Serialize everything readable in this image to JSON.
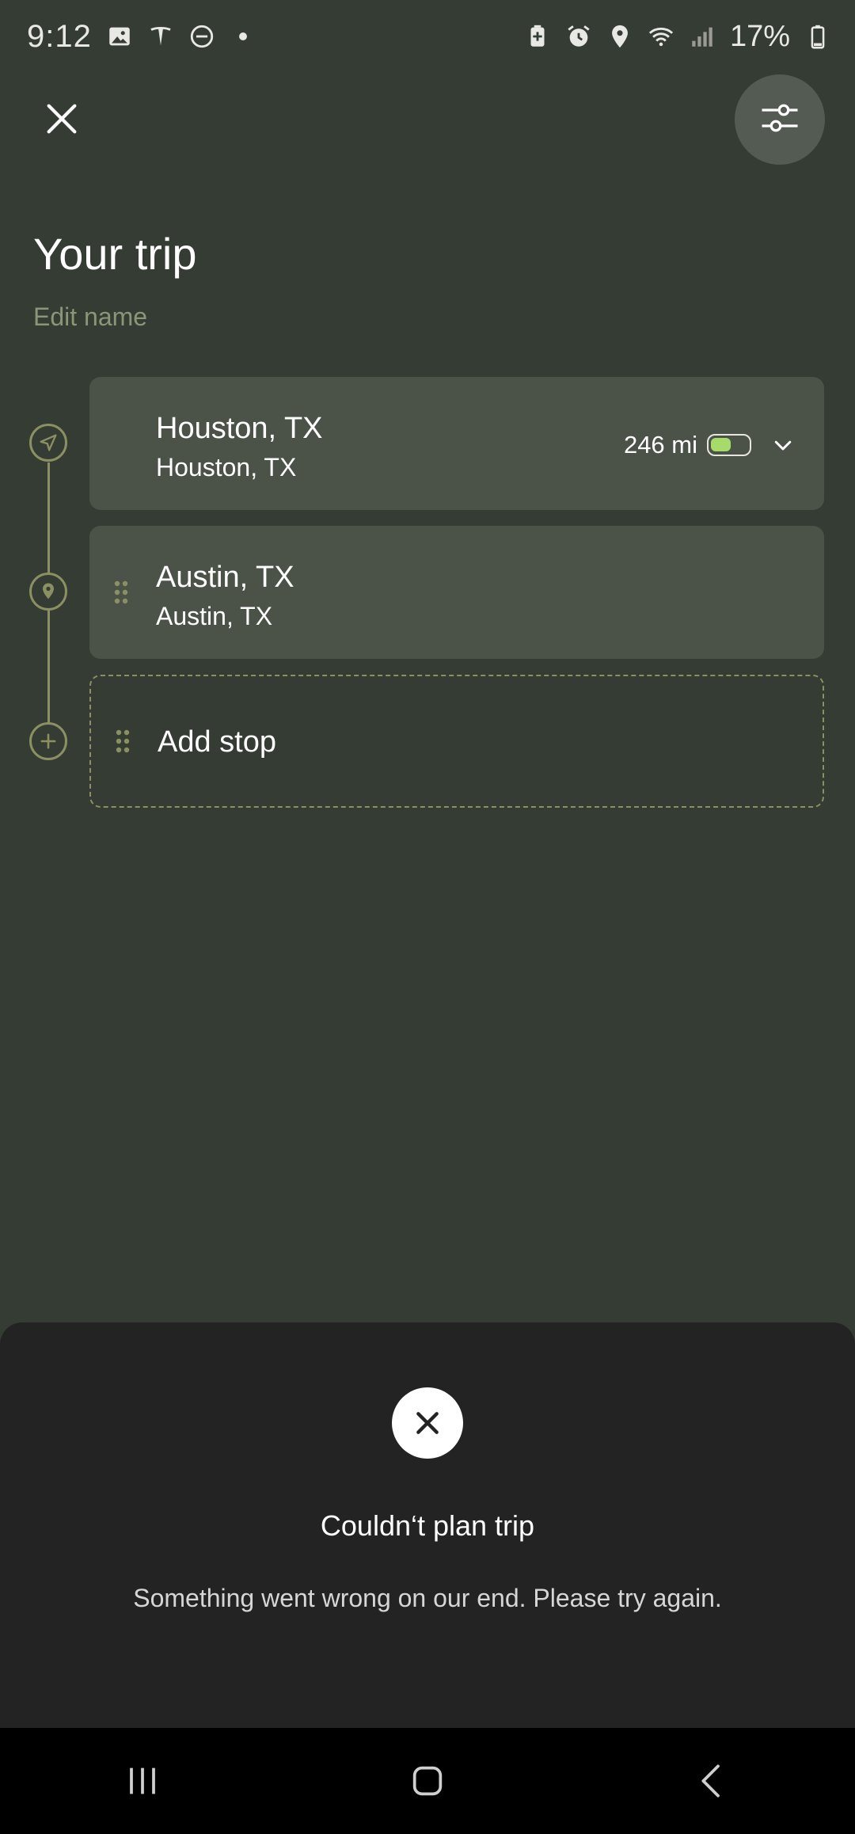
{
  "status_bar": {
    "time": "9:12",
    "battery_percent": "17%",
    "left_icons": [
      "gallery-icon",
      "tesla-icon",
      "dnd-icon",
      "dot-icon"
    ],
    "right_icons": [
      "battery-saver-icon",
      "alarm-icon",
      "location-icon",
      "wifi-icon",
      "signal-icon",
      "battery-icon"
    ]
  },
  "header": {
    "title": "Your trip",
    "edit_name_label": "Edit name"
  },
  "stops": [
    {
      "primary": "Houston, TX",
      "secondary": "Houston, TX",
      "range": "246 mi",
      "battery_level": 0.55
    },
    {
      "primary": "Austin, TX",
      "secondary": "Austin, TX"
    }
  ],
  "add_stop_label": "Add stop",
  "error_sheet": {
    "title": "Couldn‘t plan trip",
    "message": "Something went wrong on our end. Please try again."
  },
  "colors": {
    "background": "#343c33",
    "card": "#4b5349",
    "accent": "#8b9063",
    "battery_fill": "#a6db6a",
    "sheet": "#232323"
  }
}
